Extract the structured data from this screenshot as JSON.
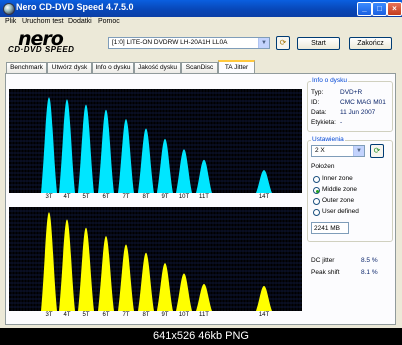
{
  "window": {
    "title": "Nero CD-DVD Speed 4.7.5.0"
  },
  "menu": [
    "Plik",
    "Uruchom test",
    "Dodatki",
    "Pomoc"
  ],
  "logo": {
    "main": "nero",
    "sub": "CD·DVD SPEED"
  },
  "drive": {
    "selected": "[1:0]   LITE-ON DVDRW LH-20A1H LL0A"
  },
  "buttons": {
    "start": "Start",
    "close": "Zakończ"
  },
  "tabs": [
    "Benchmark",
    "Utwórz dysk",
    "Info o dysku",
    "Jakość dysku",
    "ScanDisc",
    "TA Jitter"
  ],
  "active_tab": "TA Jitter",
  "disc_info": {
    "title": "Info o dysku",
    "rows": [
      {
        "label": "Typ:",
        "value": "DVD+R"
      },
      {
        "label": "ID:",
        "value": "CMC MAG M01"
      },
      {
        "label": "Data:",
        "value": "11 Jun 2007"
      },
      {
        "label": "Etykieta:",
        "value": "-"
      }
    ]
  },
  "settings": {
    "title": "Ustawienia",
    "speed": "2 X",
    "position_label": "Położen",
    "options": [
      "Inner zone",
      "Middle zone",
      "Outer zone",
      "User defined"
    ],
    "selected_option": "Middle zone",
    "user_value": "2241 MB"
  },
  "results": {
    "dc_jitter_label": "DC jitter",
    "dc_jitter_value": "8.5 %",
    "peak_shift_label": "Peak shift",
    "peak_shift_value": "8.1 %"
  },
  "chart_data": [
    {
      "type": "area",
      "title": "",
      "tick_labels": [
        "3T",
        "4T",
        "5T",
        "6T",
        "7T",
        "8T",
        "9T",
        "10T",
        "11T",
        "14T"
      ],
      "peaks": [
        0.92,
        0.9,
        0.85,
        0.8,
        0.71,
        0.62,
        0.52,
        0.42,
        0.32,
        0.22
      ],
      "color": "#00e6ff"
    },
    {
      "type": "area",
      "title": "",
      "tick_labels": [
        "3T",
        "4T",
        "5T",
        "6T",
        "7T",
        "8T",
        "9T",
        "10T",
        "11T",
        "14T"
      ],
      "peaks": [
        0.95,
        0.88,
        0.8,
        0.72,
        0.64,
        0.56,
        0.46,
        0.36,
        0.26,
        0.24
      ],
      "color": "#ffff00"
    }
  ],
  "caption": "641x526  46kb  PNG",
  "colors": {
    "titlebar": "#0847b8",
    "chart_bg": "#000000",
    "accent": "#0046d5"
  }
}
